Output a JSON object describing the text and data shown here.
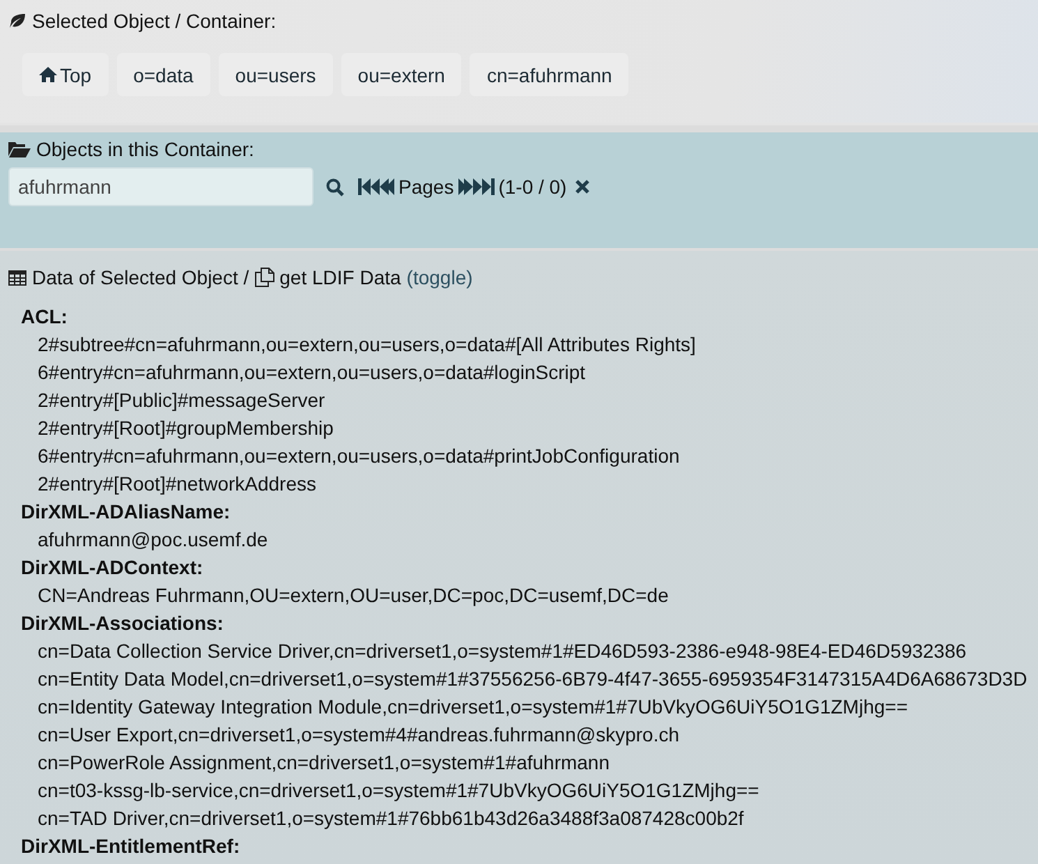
{
  "selected_object": {
    "label": "Selected Object / Container:",
    "breadcrumbs": [
      {
        "label": "Top",
        "kind": "home"
      },
      {
        "label": "o=data",
        "kind": "plain"
      },
      {
        "label": "ou=users",
        "kind": "plain"
      },
      {
        "label": "ou=extern",
        "kind": "plain"
      },
      {
        "label": "cn=afuhrmann",
        "kind": "plain"
      }
    ]
  },
  "objects": {
    "label": "Objects in this Container:",
    "search": {
      "value": "afuhrmann"
    },
    "pager": {
      "label": "Pages",
      "range": "(1-0 / 0)"
    }
  },
  "data": {
    "title": "Data of Selected Object /",
    "ldif_link": "get LDIF Data",
    "toggle_link": "(toggle)",
    "attributes": [
      {
        "name": "ACL:",
        "values": [
          "2#subtree#cn=afuhrmann,ou=extern,ou=users,o=data#[All Attributes Rights]",
          "6#entry#cn=afuhrmann,ou=extern,ou=users,o=data#loginScript",
          "2#entry#[Public]#messageServer",
          "2#entry#[Root]#groupMembership",
          "6#entry#cn=afuhrmann,ou=extern,ou=users,o=data#printJobConfiguration",
          "2#entry#[Root]#networkAddress"
        ]
      },
      {
        "name": "DirXML-ADAliasName:",
        "values": [
          "afuhrmann@poc.usemf.de"
        ]
      },
      {
        "name": "DirXML-ADContext:",
        "values": [
          "CN=Andreas Fuhrmann,OU=extern,OU=user,DC=poc,DC=usemf,DC=de"
        ]
      },
      {
        "name": "DirXML-Associations:",
        "values": [
          "cn=Data Collection Service Driver,cn=driverset1,o=system#1#ED46D593-2386-e948-98E4-ED46D5932386",
          "cn=Entity Data Model,cn=driverset1,o=system#1#37556256-6B79-4f47-3655-6959354F3147315A4D6A68673D3D",
          "cn=Identity Gateway Integration Module,cn=driverset1,o=system#1#7UbVkyOG6UiY5O1G1ZMjhg==",
          "cn=User Export,cn=driverset1,o=system#4#andreas.fuhrmann@skypro.ch",
          "cn=PowerRole Assignment,cn=driverset1,o=system#1#afuhrmann",
          "cn=t03-kssg-lb-service,cn=driverset1,o=system#1#7UbVkyOG6UiY5O1G1ZMjhg==",
          "cn=TAD Driver,cn=driverset1,o=system#1#76bb61b43d26a3488f3a087428c00b2f"
        ]
      },
      {
        "name": "DirXML-EntitlementRef:"
      }
    ]
  }
}
